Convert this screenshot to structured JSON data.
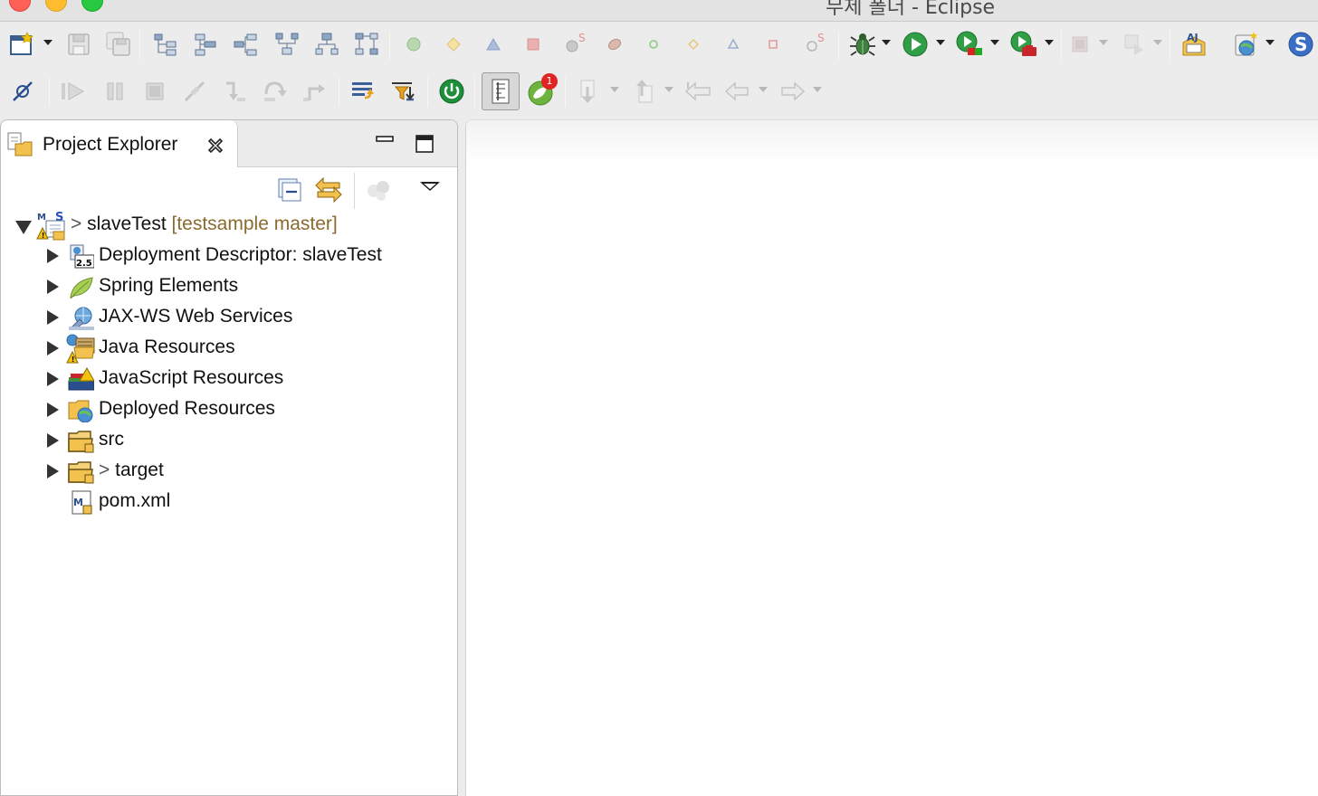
{
  "window": {
    "title": "무제 폴더 - Eclipse"
  },
  "toolbar1": {
    "buttons": [
      "new-wizard",
      "save",
      "save-all",
      "layout-1",
      "layout-2",
      "layout-3",
      "layout-4",
      "layout-5",
      "layout-6",
      "green-circle",
      "yellow-diamond",
      "blue-triangle",
      "red-square",
      "bean-s",
      "seed",
      "green-ring",
      "diamond-outline",
      "triangle-outline",
      "square-outline",
      "bean-s-outline",
      "debug",
      "run",
      "coverage",
      "run-external",
      "stop-disabled",
      "deploy-disabled",
      "open-type",
      "new-server",
      "spring-s"
    ]
  },
  "toolbar2": {
    "buttons": [
      "skip-breakpoints",
      "resume",
      "suspend",
      "terminate",
      "disconnect",
      "step-into",
      "step-over",
      "step-return",
      "drop-to-frame",
      "use-step-filters",
      "spring-boot-power",
      "toggle-mark-occurrences",
      "spring-dashboard",
      "next-annotation",
      "previous-annotation",
      "last-edit-location",
      "back",
      "forward"
    ]
  },
  "spring_dashboard": {
    "badge_count": "1"
  },
  "project_explorer": {
    "tab_label": "Project Explorer",
    "view_menu": [
      "collapse-all",
      "link-with-editor",
      "focus-on-active-task",
      "view-menu"
    ],
    "tree": [
      {
        "dirty": ">",
        "name": "slaveTest",
        "decoration": "[testsample master]",
        "expanded": true,
        "icon": "maven-spring-project-icon"
      },
      {
        "name": "Deployment Descriptor: slaveTest",
        "expanded": false,
        "icon": "deployment-descriptor-icon"
      },
      {
        "name": "Spring Elements",
        "expanded": false,
        "icon": "spring-leaf-icon"
      },
      {
        "name": "JAX-WS Web Services",
        "expanded": false,
        "icon": "jaxws-icon"
      },
      {
        "name": "Java Resources",
        "expanded": false,
        "icon": "java-resources-icon"
      },
      {
        "name": "JavaScript Resources",
        "expanded": false,
        "icon": "javascript-resources-icon"
      },
      {
        "name": "Deployed Resources",
        "expanded": false,
        "icon": "deployed-resources-icon"
      },
      {
        "name": "src",
        "expanded": false,
        "icon": "folder-icon"
      },
      {
        "dirty": ">",
        "name": "target",
        "expanded": false,
        "icon": "folder-icon"
      },
      {
        "name": "pom.xml",
        "icon": "pom-file-icon"
      }
    ]
  },
  "colors": {
    "git_decoration": "#8b6a2f",
    "background": "#ececec",
    "panel": "#ffffff"
  }
}
